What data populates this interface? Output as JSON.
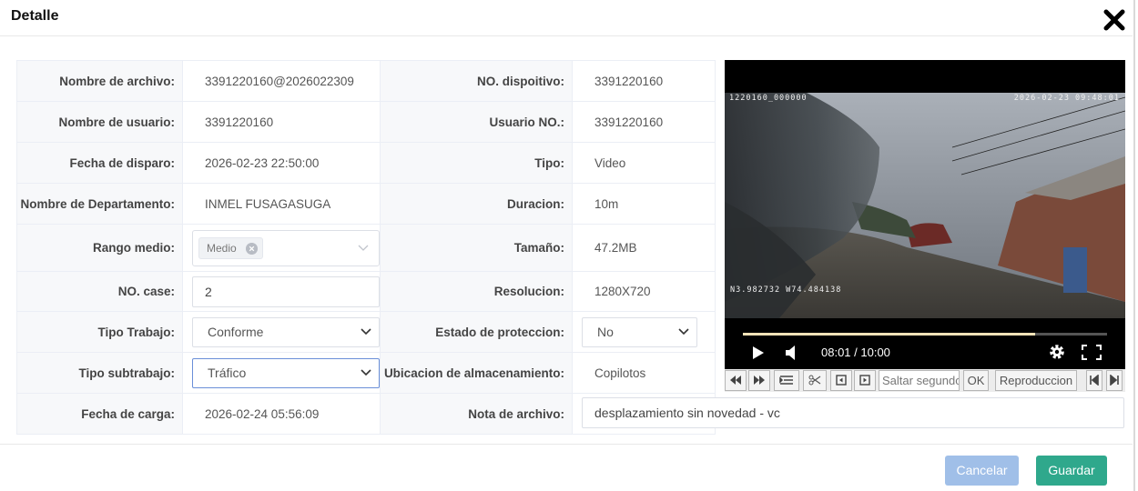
{
  "dialog": {
    "title": "Detalle",
    "close_icon": "close-x-icon"
  },
  "form": {
    "nombre_archivo": {
      "label": "Nombre de archivo:",
      "value": "3391220160@2026022309"
    },
    "nombre_usuario": {
      "label": "Nombre de usuario:",
      "value": "3391220160"
    },
    "fecha_disparo": {
      "label": "Fecha de disparo:",
      "value": "2026-02-23 22:50:00"
    },
    "departamento": {
      "label": "Nombre de Departamento:",
      "value": "INMEL FUSAGASUGA"
    },
    "rango_medio": {
      "label": "Rango medio:",
      "tag": "Medio"
    },
    "no_case": {
      "label": "NO. case:",
      "value": "2"
    },
    "tipo_trabajo": {
      "label": "Tipo Trabajo:",
      "value": "Conforme"
    },
    "tipo_subtrabajo": {
      "label": "Tipo subtrabajo:",
      "value": "Tráfico"
    },
    "fecha_carga": {
      "label": "Fecha de carga:",
      "value": "2026-02-24 05:56:09"
    },
    "no_dispositivo": {
      "label": "NO. dispoitivo:",
      "value": "3391220160"
    },
    "usuario_no": {
      "label": "Usuario NO.:",
      "value": "3391220160"
    },
    "tipo": {
      "label": "Tipo:",
      "value": "Video"
    },
    "duracion": {
      "label": "Duracion:",
      "value": "10m"
    },
    "tamano": {
      "label": "Tamaño:",
      "value": "47.2MB"
    },
    "resolucion": {
      "label": "Resolucion:",
      "value": "1280X720"
    },
    "estado_proteccion": {
      "label": "Estado de proteccion:",
      "value": "No"
    },
    "ubicacion": {
      "label": "Ubicacion de almacenamiento:",
      "value": "Copilotos"
    },
    "nota": {
      "label": "Nota de archivo:",
      "value": "desplazamiento sin novedad - vc"
    }
  },
  "player": {
    "osd_top_left": "1220160_000000",
    "osd_top_right": "2026-02-23 09:48:01",
    "osd_coords": "N3.982732 W74.484138",
    "time": "08:01 / 10:00",
    "progress": 0.802
  },
  "toolbar": {
    "jump_placeholder": "Saltar segundos",
    "ok_label": "OK",
    "play_label": "Reproduccion"
  },
  "footer": {
    "cancel_label": "Cancelar",
    "save_label": "Guardar"
  }
}
